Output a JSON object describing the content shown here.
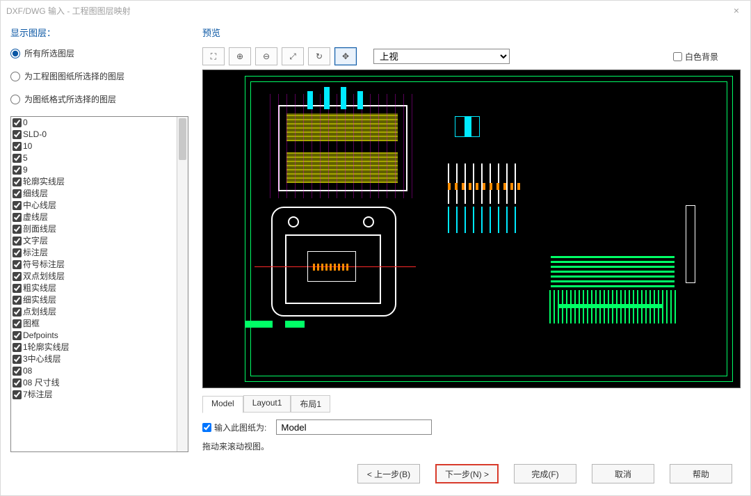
{
  "window": {
    "title": "DXF/DWG 输入 - 工程图图层映射",
    "close_glyph": "×"
  },
  "left": {
    "section": "显示图层：",
    "radios": {
      "all": "所有所选图层",
      "drawing": "为工程图图纸所选择的图层",
      "format": "为图纸格式所选择的图层"
    },
    "layers": [
      "0",
      "SLD-0",
      "10",
      "5",
      "9",
      "轮廓实线层",
      "细线层",
      "中心线层",
      "虚线层",
      "剖面线层",
      "文字层",
      "标注层",
      "符号标注层",
      "双点划线层",
      "粗实线层",
      "细实线层",
      "点划线层",
      "图框",
      "Defpoints",
      "1轮廓实线层",
      "3中心线层",
      "08",
      "08 尺寸线",
      "7标注层"
    ]
  },
  "right": {
    "title": "预览",
    "view_options": [
      "上视"
    ],
    "view_selected": "上视",
    "white_bg": "白色背景",
    "tabs": {
      "model": "Model",
      "layout1": "Layout1",
      "layout2": "布局1"
    },
    "import_chk": "输入此图纸为:",
    "import_value": "Model",
    "hint": "拖动来滚动视图。"
  },
  "buttons": {
    "back": "< 上一步(B)",
    "next": "下一步(N) >",
    "finish": "完成(F)",
    "cancel": "取消",
    "help": "帮助"
  },
  "icons": {
    "zoom_area": "⛶",
    "zoom_in": "⊕",
    "zoom_out": "⊖",
    "zoom_fit": "⤢",
    "refresh": "↻",
    "pan": "✥"
  }
}
